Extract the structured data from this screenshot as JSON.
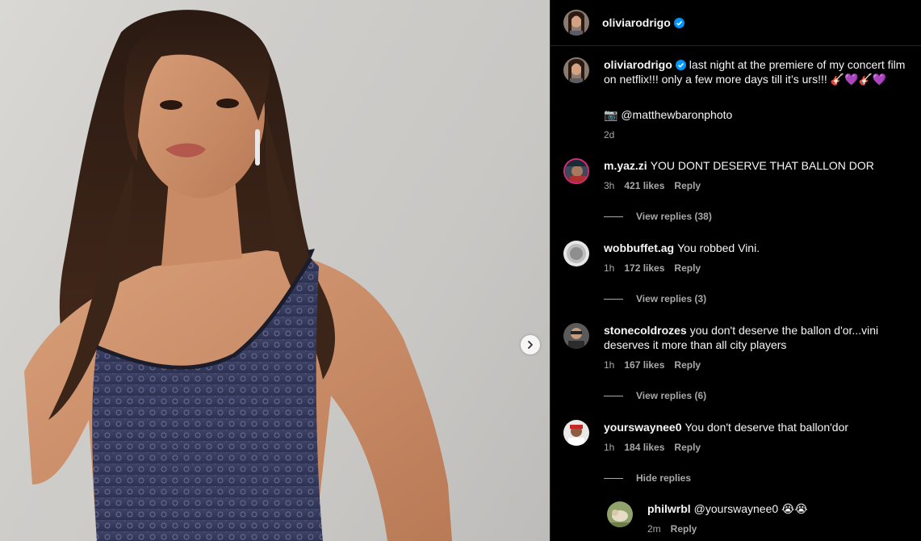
{
  "header": {
    "username": "oliviarodrigo"
  },
  "caption": {
    "username": "oliviarodrigo",
    "text": "last night at the premiere of my concert film on netflix!!! only a few more days till it’s urs!!! 🎸💜🎸💜",
    "credit_icon": "📷",
    "credit": "@matthewbaronphoto",
    "time": "2d"
  },
  "comments": [
    {
      "username": "m.yaz.zi",
      "text": "YOU DONT DESERVE THAT BALLON DOR",
      "time": "3h",
      "likes": "421 likes",
      "reply": "Reply",
      "replies_toggle": "View replies (38)"
    },
    {
      "username": "wobbuffet.ag",
      "text": "You robbed Vini.",
      "time": "1h",
      "likes": "172 likes",
      "reply": "Reply",
      "replies_toggle": "View replies (3)"
    },
    {
      "username": "stonecoldrozes",
      "text": "you don't deserve the ballon d'or...vini deserves it more than all city players",
      "time": "1h",
      "likes": "167 likes",
      "reply": "Reply",
      "replies_toggle": "View replies (6)"
    },
    {
      "username": "yourswaynee0",
      "text": "You don't deserve that ballon'dor",
      "time": "1h",
      "likes": "184 likes",
      "reply": "Reply",
      "replies_toggle": "Hide replies"
    }
  ],
  "reply": {
    "username": "philwrbl",
    "text": "@yourswaynee0 😭😭",
    "time": "2m",
    "reply": "Reply"
  },
  "colors": {
    "background": "#000000",
    "verified": "#0095f6",
    "muted": "#a8a8a8",
    "divider": "#262626"
  },
  "icons": {
    "verified": "verified-badge-icon",
    "next": "chevron-right-icon"
  }
}
